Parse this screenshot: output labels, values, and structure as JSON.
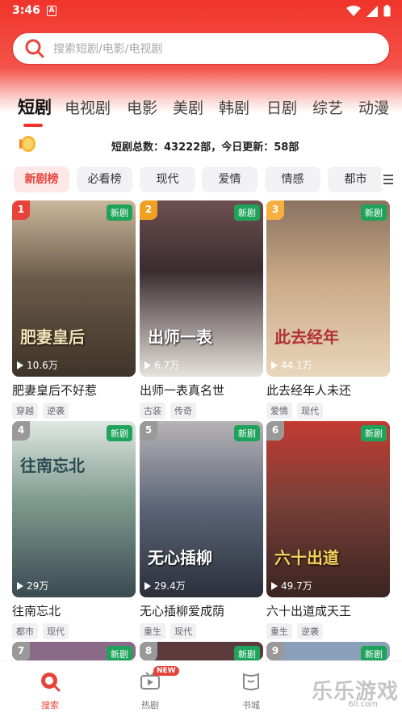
{
  "status_bar": {
    "time": "3:46",
    "notif_letter": "A"
  },
  "search": {
    "placeholder": "搜索短剧/电影/电视剧"
  },
  "categories": [
    {
      "label": "短剧",
      "active": true
    },
    {
      "label": "电视剧"
    },
    {
      "label": "电影"
    },
    {
      "label": "美剧"
    },
    {
      "label": "韩剧"
    },
    {
      "label": "日剧"
    },
    {
      "label": "综艺"
    },
    {
      "label": "动漫"
    }
  ],
  "stats": {
    "text": "短剧总数：43222部，今日更新：58部"
  },
  "filters": [
    {
      "label": "新剧榜",
      "active": true
    },
    {
      "label": "必看榜"
    },
    {
      "label": "现代"
    },
    {
      "label": "爱情"
    },
    {
      "label": "情感"
    },
    {
      "label": "都市"
    }
  ],
  "cards": [
    {
      "rank": "1",
      "badge": "新剧",
      "views": "10.6万",
      "title": "肥妻皇后不好惹",
      "poster_text": "肥妻皇后",
      "tags": [
        "穿越",
        "逆袭"
      ],
      "rank_color": "#e8433a",
      "bg": "#6b5a48"
    },
    {
      "rank": "2",
      "badge": "新剧",
      "views": "6.7万",
      "title": "出师一表真名世",
      "poster_text": "出师一表",
      "tags": [
        "古装",
        "传奇"
      ],
      "rank_color": "#f0a020",
      "bg": "#4a3a40"
    },
    {
      "rank": "3",
      "badge": "新剧",
      "views": "44.1万",
      "title": "此去经年人未还",
      "poster_text": "此去经年",
      "tags": [
        "爱情",
        "现代"
      ],
      "rank_color": "#f5b041",
      "bg": "#c9a987"
    },
    {
      "rank": "4",
      "badge": "新剧",
      "views": "29万",
      "title": "往南忘北",
      "poster_text": "往南忘北",
      "tags": [
        "都市",
        "现代"
      ],
      "rank_color": "#999999",
      "bg": "#7f9b8e"
    },
    {
      "rank": "5",
      "badge": "新剧",
      "views": "29.4万",
      "title": "无心插柳爱成荫",
      "poster_text": "无心插柳",
      "tags": [
        "重生",
        "现代"
      ],
      "rank_color": "#999999",
      "bg": "#5a6476"
    },
    {
      "rank": "6",
      "badge": "新剧",
      "views": "49.7万",
      "title": "六十出道成天王",
      "poster_text": "六十出道",
      "tags": [
        "重生",
        "逆袭"
      ],
      "rank_color": "#999999",
      "bg": "#7a4038"
    },
    {
      "rank": "7",
      "badge": "新剧",
      "bg": "#8a6a88",
      "rank_color": "#999999"
    },
    {
      "rank": "8",
      "badge": "新剧",
      "bg": "#5a3a3a",
      "rank_color": "#999999"
    },
    {
      "rank": "9",
      "badge": "新剧",
      "bg": "#8aa0b8",
      "rank_color": "#999999"
    }
  ],
  "bottom_nav": [
    {
      "label": "搜索",
      "icon": "search-icon",
      "active": true
    },
    {
      "label": "热剧",
      "icon": "tv-icon",
      "badge": "NEW"
    },
    {
      "label": "书城",
      "icon": "book-icon"
    }
  ],
  "watermark": {
    "main": "乐乐游戏",
    "sub": "6ll.com"
  },
  "colors": {
    "accent": "#e8433a",
    "new_badge": "#1fa35b"
  }
}
